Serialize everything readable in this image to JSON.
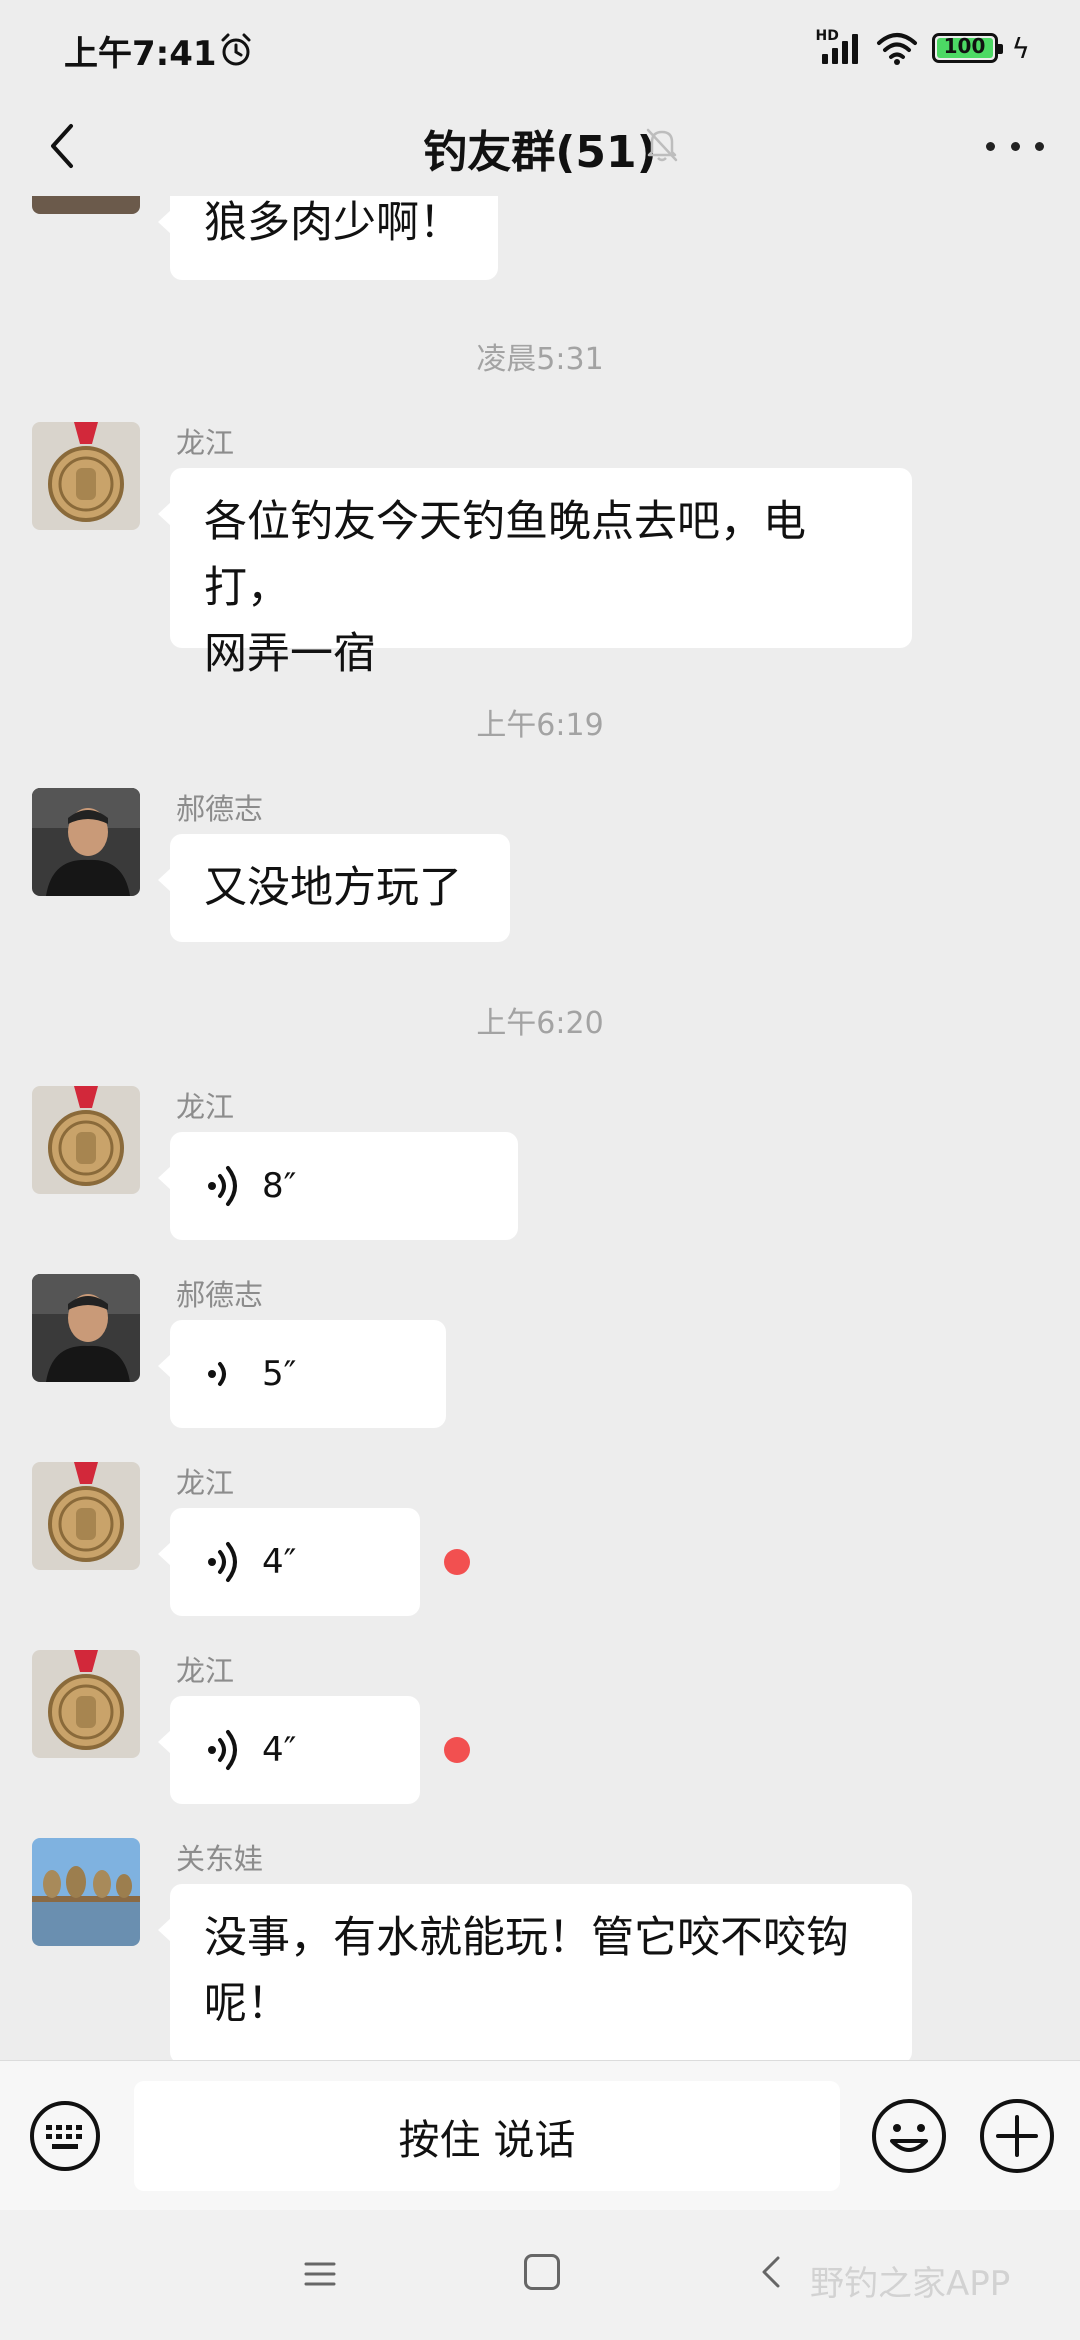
{
  "status_bar": {
    "time": "上午7:41",
    "network": "HD",
    "battery": "100"
  },
  "header": {
    "title": "钓友群(51)"
  },
  "messages": [
    {
      "type": "text",
      "text": "狼多肉少啊！"
    },
    {
      "type": "time",
      "text": "凌晨5:31"
    },
    {
      "type": "text",
      "sender": "龙江",
      "lines": [
        "各位钓友今天钓鱼晚点去吧，电打，",
        "网弄一宿"
      ]
    },
    {
      "type": "time",
      "text": "上午6:19"
    },
    {
      "type": "text",
      "sender": "郝德志",
      "text": "又没地方玩了"
    },
    {
      "type": "time",
      "text": "上午6:20"
    },
    {
      "type": "voice",
      "sender": "龙江",
      "duration": "8″",
      "unread": false
    },
    {
      "type": "voice",
      "sender": "郝德志",
      "duration": "5″",
      "unread": false
    },
    {
      "type": "voice",
      "sender": "龙江",
      "duration": "4″",
      "unread": true
    },
    {
      "type": "voice",
      "sender": "龙江",
      "duration": "4″",
      "unread": true
    },
    {
      "type": "text",
      "sender": "关东娃",
      "lines": [
        "没事，有水就能玩！管它咬不咬钩",
        "呢！"
      ]
    }
  ],
  "input_bar": {
    "hold_to_talk": "按住 说话"
  },
  "nav_bar": {
    "watermark": "野钓之家APP"
  },
  "colors": {
    "background": "#ededed",
    "bubble": "#ffffff",
    "unread_dot": "#f25050",
    "timestamp": "#a3a3a3"
  }
}
